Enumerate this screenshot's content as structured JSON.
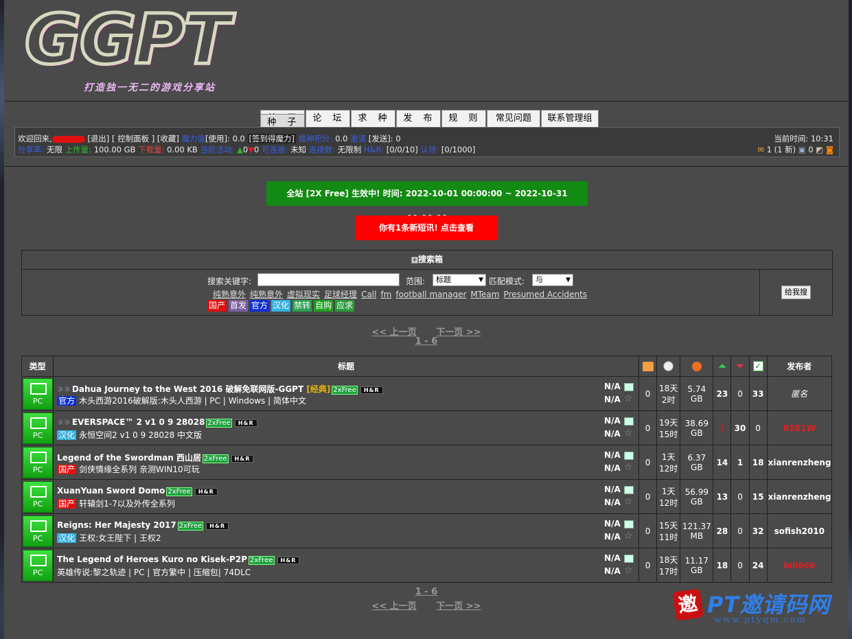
{
  "header": {
    "logo_text": "GGPT",
    "slogan": "打造独一无二的游戏分享站"
  },
  "nav": {
    "tabs": [
      "首 页",
      "论 坛",
      "种 子",
      "求 种",
      "发 布",
      "规 则",
      "常见问题",
      "联系管理组"
    ],
    "selected": "种 子"
  },
  "userbar": {
    "welcome": "欢迎回来,",
    "logout": "[退出]",
    "control_panel": "[ 控制面板 ]",
    "favorites": "[收藏]",
    "magic_label": "魔力值",
    "use_label": "[使用]:",
    "magic_value": "0.0",
    "checkin": "[签到得魔力]",
    "seed_points_label": "做种积分:",
    "seed_points_value": "0.0",
    "invite_label": "邀请",
    "sent_label": "[发送]:",
    "sent_value": "0",
    "ratio_label": "分享率:",
    "ratio_value": "无限",
    "upload_label": "上传量:",
    "upload_value": "100.00 GB",
    "download_label": "下载量:",
    "download_value": "0.00 KB",
    "active_label": "当前活动:",
    "active_up": "0",
    "active_down": "0",
    "connectable_label": "可连接:",
    "connectable_value": "未知",
    "conn_count_label": "连接数:",
    "conn_count_value": "无限制",
    "hr_label": "H&R:",
    "hr_value": "[0/0/10]",
    "claim_label": "认领:",
    "claim_value": "[0/1000]",
    "time_label": "当前时间:",
    "time_value": "10:31",
    "messages": "1 (1 新)",
    "friends": "0"
  },
  "banners": {
    "free": "全站 [2X Free] 生效中! 时间: 2022-10-01 00:00:00 ~ 2022-10-31 00:00:00",
    "message": "你有1条新短讯! 点击查看"
  },
  "search": {
    "title": "搜索箱",
    "keyword_label": "搜索关键字:",
    "keyword_value": "",
    "scope_label": "范围:",
    "scope_value": "标题",
    "match_label": "匹配模式:",
    "match_value": "与",
    "button": "给我搜",
    "hot_keywords": [
      "纯熟意外",
      "纯熟意外",
      "虚拟现实",
      "足球经理",
      "Call",
      "fm",
      "football manager",
      "MTeam",
      "Presumed Accidents"
    ],
    "tags": [
      "国产",
      "首发",
      "官方",
      "汉化",
      "禁转",
      "自购",
      "应求"
    ]
  },
  "pager_top": {
    "prev": "<< 上一页",
    "next": "下一页 >>",
    "range": "1 - 6"
  },
  "pager_bottom": {
    "prev": "<< 上一页",
    "next": "下一页 >>",
    "range": "1 - 6"
  },
  "table": {
    "headers": {
      "type": "类型",
      "title": "标题",
      "uploader": "发布者"
    },
    "rows": [
      {
        "cat": "PC",
        "sticky": "⚞⚞",
        "title": "Dahua Journey to the West 2016 破解免联网版-GGPT",
        "classic": "[经典]",
        "free": "2xFree",
        "hr": "H&R",
        "tag": "官方",
        "tag_color": "#1030d0",
        "subtitle": "木头西游2016破解版:木头人西游 | PC | Windows | 简体中文",
        "na1": "N/A",
        "na2": "N/A",
        "comments": "0",
        "age1": "18天",
        "age2": "2时",
        "size1": "5.74",
        "size2": "GB",
        "seeders": "23",
        "leechers": "0",
        "completed": "33",
        "uploader": "匿名",
        "uploader_style": "anon"
      },
      {
        "cat": "PC",
        "sticky": "⚞⚞",
        "title": "EVERSPACE™ 2 v1 0 9 28028",
        "classic": "",
        "free": "2xFree",
        "hr": "H&R",
        "tag": "汉化",
        "tag_color": "#33b0e0",
        "subtitle": "永恒空间2 v1 0 9 28028 中文版",
        "na1": "N/A",
        "na2": "N/A",
        "comments": "0",
        "age1": "19天",
        "age2": "15时",
        "size1": "38.69",
        "size2": "GB",
        "seeders": "1",
        "leechers": "30",
        "completed": "0",
        "uploader": "RSE1W",
        "uploader_style": "red",
        "seeders_red": true
      },
      {
        "cat": "PC",
        "sticky": "",
        "title": "Legend of the Swordman 西山居",
        "classic": "",
        "free": "2xFree",
        "hr": "H&R",
        "tag": "国产",
        "tag_color": "#e01010",
        "subtitle": "剑侠情缘全系列 亲测WIN10可玩",
        "na1": "N/A",
        "na2": "N/A",
        "comments": "0",
        "age1": "1天",
        "age2": "12时",
        "size1": "6.37",
        "size2": "GB",
        "seeders": "14",
        "leechers": "1",
        "completed": "18",
        "uploader": "xianrenzheng",
        "uploader_style": "normal"
      },
      {
        "cat": "PC",
        "sticky": "",
        "title": "XuanYuan Sword Domo",
        "classic": "",
        "free": "2xFree",
        "hr": "H&R",
        "tag": "国产",
        "tag_color": "#e01010",
        "subtitle": "轩辕剑1-7以及外传全系列",
        "na1": "N/A",
        "na2": "N/A",
        "comments": "0",
        "age1": "1天",
        "age2": "12时",
        "size1": "56.99",
        "size2": "GB",
        "seeders": "13",
        "leechers": "0",
        "completed": "15",
        "uploader": "xianrenzheng",
        "uploader_style": "normal"
      },
      {
        "cat": "PC",
        "sticky": "",
        "title": "Reigns: Her Majesty 2017",
        "classic": "",
        "free": "2xFree",
        "hr": "H&R",
        "tag": "汉化",
        "tag_color": "#33b0e0",
        "subtitle": "王权:女王陛下 | 王权2",
        "na1": "N/A",
        "na2": "N/A",
        "comments": "0",
        "age1": "15天",
        "age2": "11时",
        "size1": "121.37",
        "size2": "MB",
        "seeders": "28",
        "leechers": "0",
        "completed": "32",
        "uploader": "sofish2010",
        "uploader_style": "normal"
      },
      {
        "cat": "PC",
        "sticky": "",
        "title": "The Legend of Heroes Kuro no Kisek-P2P",
        "classic": "",
        "free": "2xFree",
        "hr": "H&R",
        "tag": "",
        "tag_color": "",
        "subtitle": "英雄传说:黎之轨迹 | PC | 官方繁中 | 压缩包| 74DLC",
        "na1": "N/A",
        "na2": "N/A",
        "comments": "0",
        "age1": "18天",
        "age2": "17时",
        "size1": "11.17",
        "size2": "GB",
        "seeders": "18",
        "leechers": "0",
        "completed": "24",
        "uploader": "bill666",
        "uploader_style": "red"
      }
    ]
  },
  "watermark": {
    "seal": "邀",
    "title": "PT邀请码网",
    "url": "www.ptyqm.com"
  },
  "colors": {
    "free_banner": "#138a13",
    "msg_banner": "#ff0000",
    "category_green": "#22c022"
  }
}
